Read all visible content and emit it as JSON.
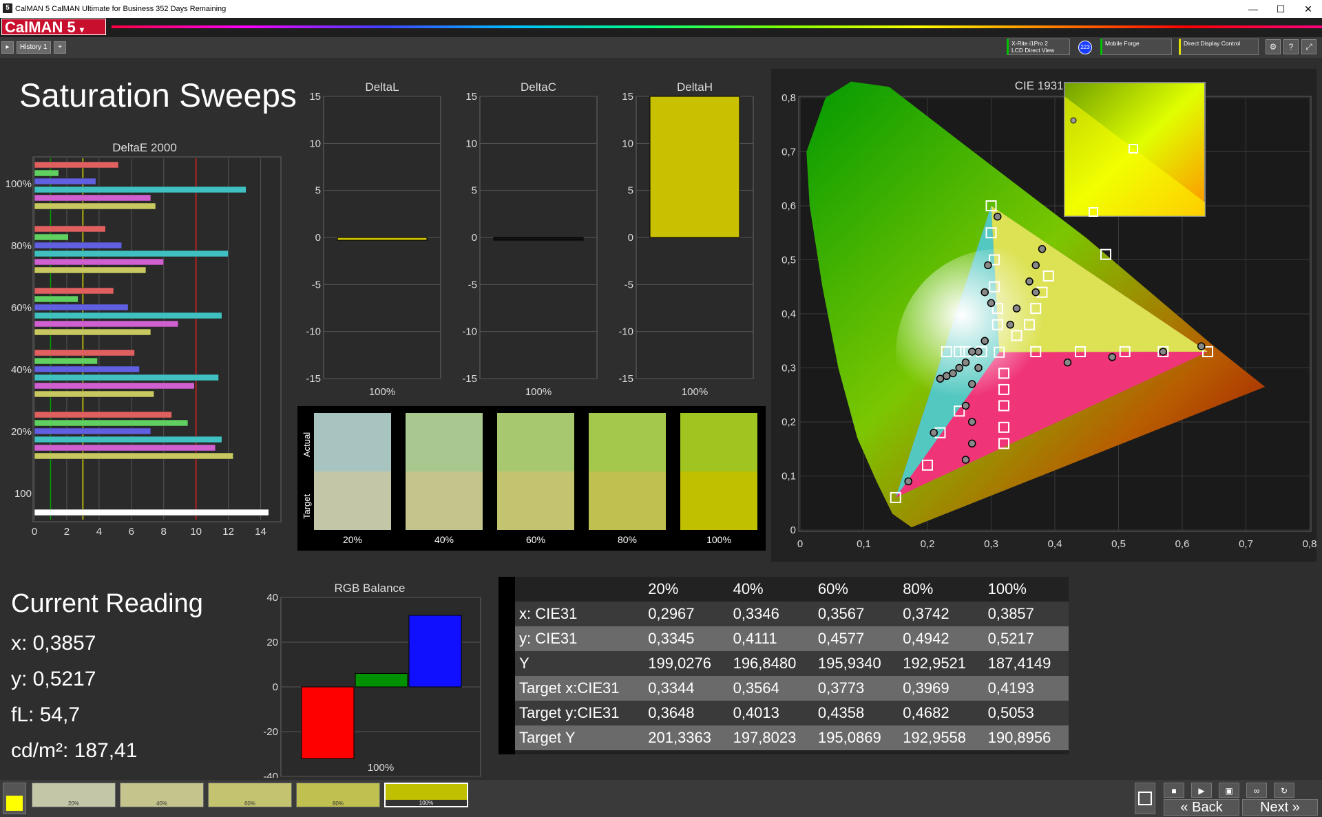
{
  "window": {
    "title": "CalMAN 5 CalMAN Ultimate for Business 352 Days Remaining",
    "app_icon": "5",
    "min": "—",
    "max": "☐",
    "close": "✕"
  },
  "app": {
    "logo": "CalMAN 5",
    "accent": "#c8102e"
  },
  "tabs": {
    "history_label": "History 1",
    "add": "+"
  },
  "devices": {
    "meter_line1": "X-Rite i1Pro 2",
    "meter_line2": "LCD Direct View",
    "badge": "223",
    "source": "Mobile Forge",
    "display": "Direct Display Control"
  },
  "page": {
    "title": "Saturation Sweeps"
  },
  "deltae": {
    "title": "DeltaE 2000",
    "group_labels": [
      "100%",
      "80%",
      "60%",
      "40%",
      "20%",
      "100"
    ],
    "xticks": [
      "0",
      "2",
      "4",
      "6",
      "8",
      "10",
      "12",
      "14"
    ]
  },
  "small_charts": [
    {
      "title": "DeltaL",
      "xlabel": "100%",
      "value": -0.3,
      "color": "#c8c000"
    },
    {
      "title": "DeltaC",
      "xlabel": "100%",
      "value": 0.0,
      "color": "#111111"
    },
    {
      "title": "DeltaH",
      "xlabel": "100%",
      "value": 15,
      "color": "#c8c000"
    }
  ],
  "small_ticks": [
    "15",
    "10",
    "5",
    "0",
    "-5",
    "-10",
    "-15"
  ],
  "swatches": {
    "actual_label": "Actual",
    "target_label": "Target",
    "items": [
      {
        "label": "20%",
        "actual": "#a8c4c0",
        "target": "#c4c6a8"
      },
      {
        "label": "40%",
        "actual": "#a8c890",
        "target": "#c4c48c"
      },
      {
        "label": "60%",
        "actual": "#a8c870",
        "target": "#c4c470"
      },
      {
        "label": "80%",
        "actual": "#a4c84c",
        "target": "#c0c050"
      },
      {
        "label": "100%",
        "actual": "#a0c420",
        "target": "#c0c000"
      }
    ]
  },
  "cie": {
    "title": "CIE 1931 xy",
    "xticks": [
      "0",
      "0,1",
      "0,2",
      "0,3",
      "0,4",
      "0,5",
      "0,6",
      "0,7",
      "0,8"
    ],
    "yticks": [
      "0",
      "0,1",
      "0,2",
      "0,3",
      "0,4",
      "0,5",
      "0,6",
      "0,7",
      "0,8"
    ]
  },
  "current_reading": {
    "title": "Current Reading",
    "x": "x: 0,3857",
    "y": "y: 0,5217",
    "fl": "fL: 54,7",
    "cd": "cd/m²: 187,41"
  },
  "rgb_balance": {
    "title": "RGB Balance",
    "xlabel": "100%",
    "yticks": [
      "40",
      "20",
      "0",
      "-20",
      "-40"
    ],
    "values": {
      "red": -32,
      "green": 6,
      "blue": 32
    }
  },
  "chart_data": [
    {
      "type": "bar",
      "title": "DeltaE 2000",
      "orientation": "horizontal",
      "xlim": [
        0,
        15
      ],
      "groups": [
        "100%",
        "80%",
        "60%",
        "40%",
        "20%",
        "100"
      ],
      "series_colors": [
        "#e06060",
        "#60d060",
        "#6060e0",
        "#40c0c0",
        "#d060d0",
        "#c8c860"
      ],
      "values": [
        [
          5.2,
          1.5,
          3.8,
          13.1,
          7.2,
          7.5
        ],
        [
          4.4,
          2.1,
          5.4,
          12.0,
          8.0,
          6.9
        ],
        [
          4.9,
          2.7,
          5.8,
          11.6,
          8.9,
          7.2
        ],
        [
          6.2,
          3.9,
          6.5,
          11.4,
          9.9,
          7.4
        ],
        [
          8.5,
          9.5,
          7.2,
          11.6,
          11.2,
          12.3
        ],
        [
          14.5
        ]
      ],
      "reference_lines": [
        1,
        3,
        10
      ]
    },
    {
      "type": "table",
      "columns": [
        "",
        "20%",
        "40%",
        "60%",
        "80%",
        "100%"
      ],
      "rows": [
        [
          "x: CIE31",
          "0,2967",
          "0,3346",
          "0,3567",
          "0,3742",
          "0,3857"
        ],
        [
          "y: CIE31",
          "0,3345",
          "0,4111",
          "0,4577",
          "0,4942",
          "0,5217"
        ],
        [
          "Y",
          "199,0276",
          "196,8480",
          "195,9340",
          "192,9521",
          "187,4149"
        ],
        [
          "Target x:CIE31",
          "0,3344",
          "0,3564",
          "0,3773",
          "0,3969",
          "0,4193"
        ],
        [
          "Target y:CIE31",
          "0,3648",
          "0,4013",
          "0,4358",
          "0,4682",
          "0,5053"
        ],
        [
          "Target Y",
          "201,3363",
          "197,8023",
          "195,0869",
          "192,9558",
          "190,8956"
        ]
      ]
    }
  ],
  "footer": {
    "swatches": [
      {
        "label": "20%",
        "color": "#c4c6a8"
      },
      {
        "label": "40%",
        "color": "#c4c48c"
      },
      {
        "label": "60%",
        "color": "#c4c470"
      },
      {
        "label": "80%",
        "color": "#c0c050"
      },
      {
        "label": "100%",
        "color": "#c0c000"
      }
    ],
    "back": "Back",
    "next": "Next"
  }
}
